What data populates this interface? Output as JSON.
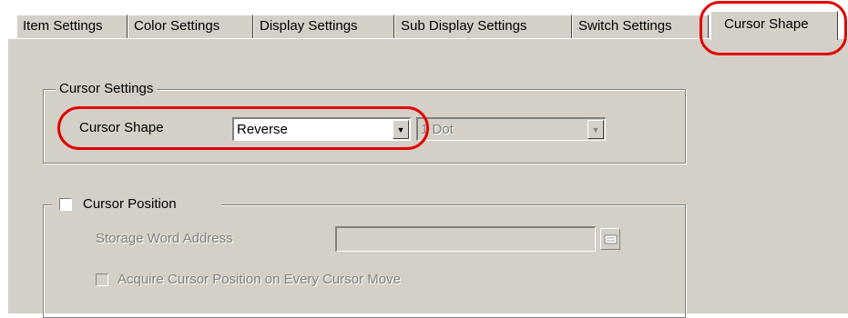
{
  "tabs": [
    {
      "label": "Item Settings"
    },
    {
      "label": "Color Settings"
    },
    {
      "label": "Display Settings"
    },
    {
      "label": "Sub Display Settings"
    },
    {
      "label": "Switch Settings"
    },
    {
      "label": "Cursor Shape"
    }
  ],
  "cursor_settings": {
    "legend": "Cursor Settings",
    "shape_label": "Cursor Shape",
    "shape_value": "Reverse",
    "size_value": "1 Dot"
  },
  "cursor_position": {
    "legend": "Cursor Position",
    "checked": false,
    "storage_label": "Storage Word Address",
    "storage_value": "",
    "acquire_label": "Acquire Cursor Position on Every Cursor Move",
    "acquire_checked": false
  },
  "colors": {
    "highlight": "#e00000",
    "dialog_bg": "#d4d0c8"
  }
}
